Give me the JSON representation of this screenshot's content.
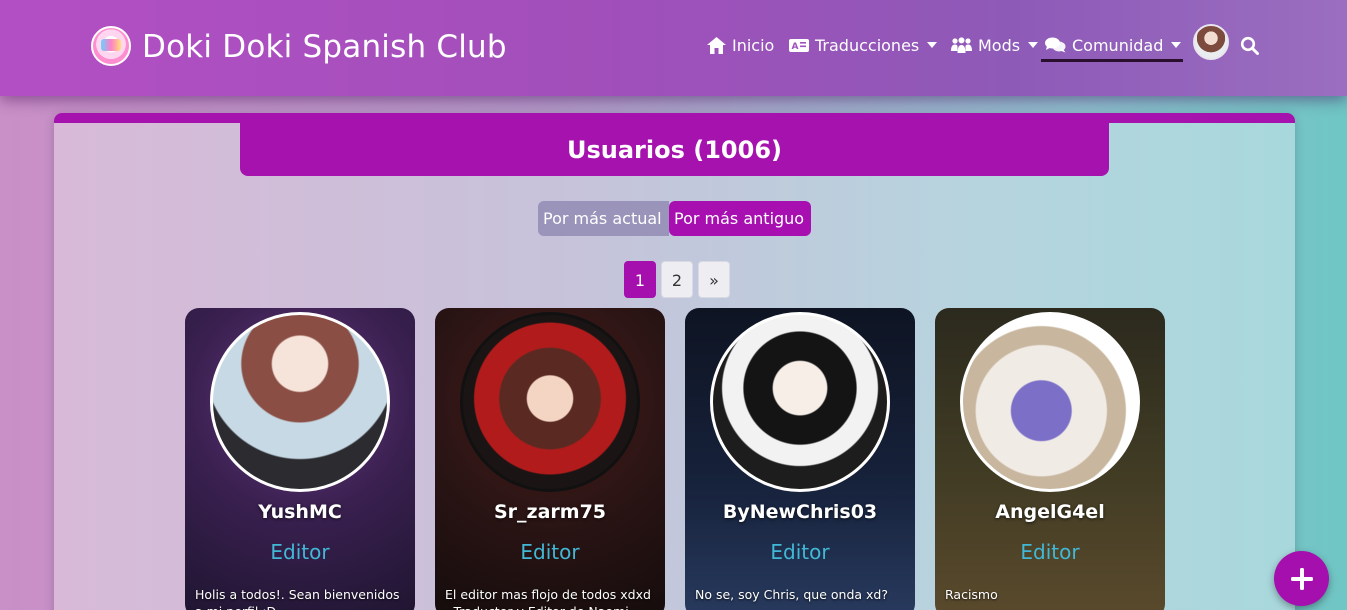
{
  "site": {
    "title": "Doki Doki Spanish Club"
  },
  "nav": {
    "items": [
      {
        "label": "Inicio",
        "icon": "home-icon",
        "dropdown": false
      },
      {
        "label": "Traducciones",
        "icon": "translate-icon",
        "dropdown": true
      },
      {
        "label": "Mods",
        "icon": "users-group-icon",
        "dropdown": true
      },
      {
        "label": "Comunidad",
        "icon": "comments-icon",
        "dropdown": true,
        "active": true
      }
    ]
  },
  "header": {
    "title": "Usuarios (1006)"
  },
  "sort": {
    "newest": "Por más actual",
    "oldest": "Por más antiguo",
    "selected": "oldest"
  },
  "pagination": {
    "pages": [
      "1",
      "2"
    ],
    "next": "»",
    "current": "1"
  },
  "users": [
    {
      "name": "YushMC",
      "role": "Editor",
      "bio": "Holis a todos!. Sean bienvenidos a mi perfil :D"
    },
    {
      "name": "Sr_zarm75",
      "role": "Editor",
      "bio": "El editor mas flojo de todos xdxd - Traductor y Editor de Naomi"
    },
    {
      "name": "ByNewChris03",
      "role": "Editor",
      "bio": "No se, soy Chris, que onda xd?"
    },
    {
      "name": "AngelG4el",
      "role": "Editor",
      "bio": "Racismo"
    }
  ],
  "colors": {
    "brand": "#a512ad",
    "role": "#41b8d6"
  },
  "fab": {
    "icon": "plus-icon"
  }
}
